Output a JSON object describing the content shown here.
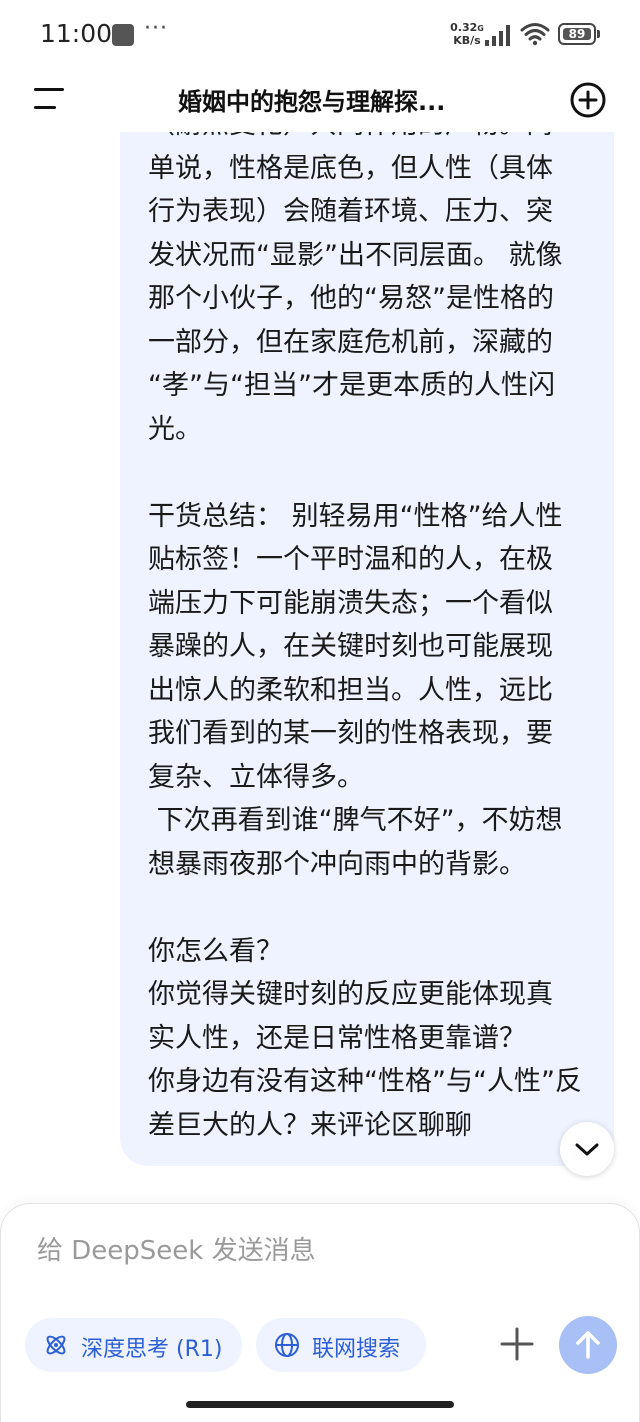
{
  "status_bar": {
    "time": "11:00",
    "more": "···",
    "net_speed_value": "0.32",
    "net_speed_unit_g": "G",
    "net_speed_unit": "KB/s",
    "battery": "89"
  },
  "header": {
    "title": "婚姻中的抱怨与理解探..."
  },
  "message": {
    "lines": [
      "（耐点变化）共同作用的产物。简",
      "单说，性格是底色，但人性（具体",
      "行为表现）会随着环境、压力、突",
      "发状况而“显影”出不同层面。 就像",
      "那个小伙子，他的“易怒”是性格的",
      "一部分，但在家庭危机前，深藏的",
      "“孝”与“担当”才是更本质的人性闪",
      "光。",
      "",
      "干货总结： 别轻易用“性格”给人性",
      "贴标签！一个平时温和的人，在极",
      "端压力下可能崩溃失态；一个看似",
      "暴躁的人，在关键时刻也可能展现",
      "出惊人的柔软和担当。人性，远比",
      "我们看到的某一刻的性格表现，要",
      "复杂、立体得多。",
      " 下次再看到谁“脾气不好”，不妨想",
      "想暴雨夜那个冲向雨中的背影。",
      "",
      "你怎么看？",
      "你觉得关键时刻的反应更能体现真",
      "实人性，还是日常性格更靠谱？",
      "你身边有没有这种“性格”与“人性”反",
      "差巨大的人？来评论区聊聊"
    ]
  },
  "composer": {
    "placeholder": "给 DeepSeek 发送消息",
    "deep_think_label": "深度思考 (R1)",
    "web_search_label": "联网搜索"
  },
  "icons": {
    "menu": "menu-icon",
    "new_chat": "plus-circle-icon",
    "scroll_down": "chevron-down-icon",
    "deep_think": "atom-icon",
    "web_search": "globe-icon",
    "add": "plus-icon",
    "send": "arrow-up-icon"
  },
  "colors": {
    "bubble_background": "#eef3ff",
    "accent": "#2c5fd6",
    "send_button": "#a9c0f6"
  }
}
